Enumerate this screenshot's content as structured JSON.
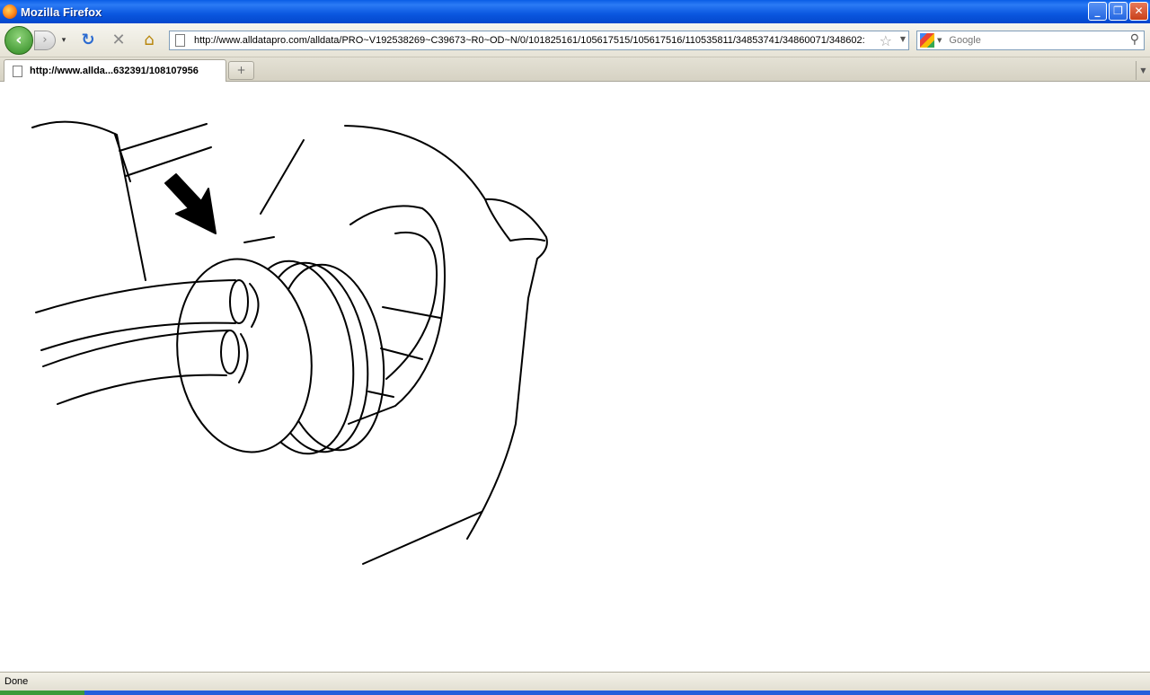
{
  "window": {
    "title": "Mozilla Firefox",
    "minimize_glyph": "_",
    "restore_glyph": "❐",
    "close_glyph": "✕"
  },
  "nav": {
    "back_glyph": "‹",
    "forward_glyph": "›",
    "history_glyph": "▾",
    "reload_glyph": "↻",
    "stop_glyph": "✕",
    "home_glyph": "⌂",
    "url": "http://www.alldatapro.com/alldata/PRO~V192538269~C39673~R0~OD~N/0/101825161/105617515/105617516/110535811/34853741/34860071/348602:",
    "bookmark_glyph": "☆",
    "url_dropdown_glyph": "▼"
  },
  "search": {
    "engine_dropdown_glyph": "▼",
    "placeholder": "Google",
    "go_glyph": "⚲"
  },
  "tabs": [
    {
      "label": "http://www.allda...632391/108107956"
    }
  ],
  "tabstrip": {
    "new_tab_glyph": "+",
    "list_glyph": "▼"
  },
  "status": {
    "text": "Done"
  },
  "icons": {
    "app": "firefox-icon",
    "page": "page-icon",
    "search_engine": "google-icon",
    "search": "magnifier-icon"
  },
  "colors": {
    "titlebar": "#0a57e0",
    "back_button": "#2f8a22",
    "reload": "#2a6ad0"
  }
}
